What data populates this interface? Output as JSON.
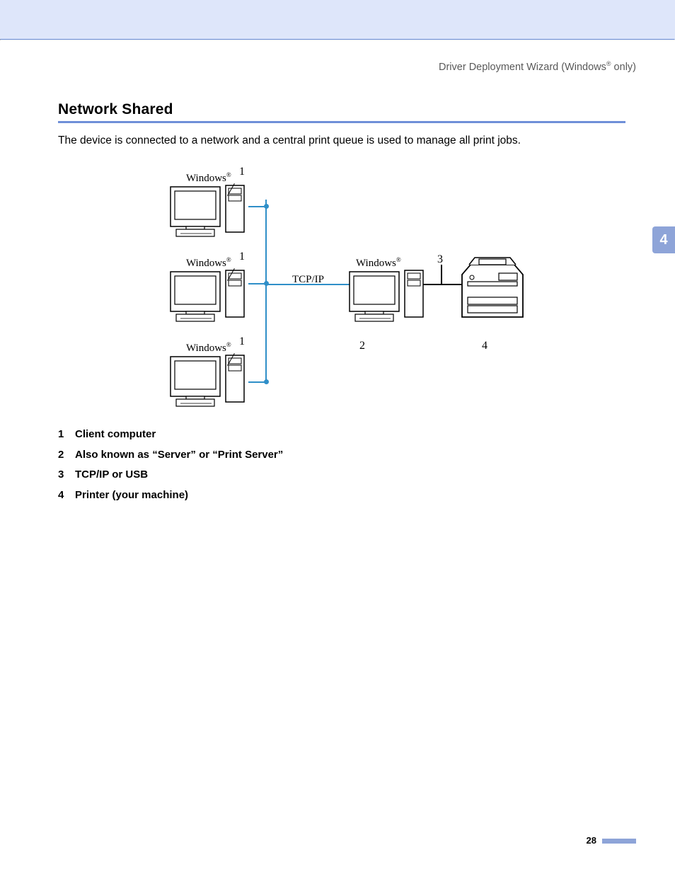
{
  "header": {
    "prefix": "Driver Deployment Wizard (Windows",
    "reg": "®",
    "suffix": " only)"
  },
  "section": {
    "title": "Network Shared",
    "intro": "The device is connected to a network and a central print queue is used to manage all print jobs."
  },
  "diagram": {
    "labels": {
      "windows": "Windows",
      "reg": "®",
      "tcpip": "TCP/IP",
      "n1": "1",
      "n2": "2",
      "n3": "3",
      "n4": "4"
    }
  },
  "legend": [
    {
      "num": "1",
      "text": "Client computer"
    },
    {
      "num": "2",
      "text": "Also known as “Server” or “Print Server”"
    },
    {
      "num": "3",
      "text": "TCP/IP or USB"
    },
    {
      "num": "4",
      "text": "Printer (your machine)"
    }
  ],
  "sidebar": {
    "chapter": "4"
  },
  "footer": {
    "page": "28"
  }
}
